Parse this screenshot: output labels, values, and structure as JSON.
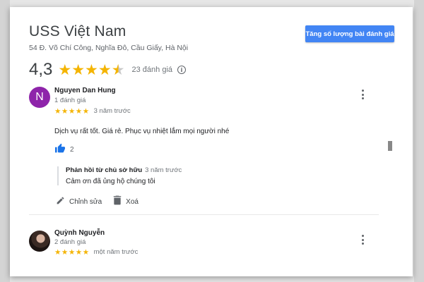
{
  "place": {
    "name": "USS Việt Nam",
    "address": "54 Đ. Võ Chí Công, Nghĩa Đô, Cầu Giấy, Hà Nội"
  },
  "cta_label": "Tăng số lượng bài đánh giá",
  "rating": {
    "value": "4,3",
    "stars": 4.3,
    "count_label": "23 đánh giá",
    "star_color": "#f4b400"
  },
  "reviews": [
    {
      "name": "Nguyen Dan Hung",
      "avatar_letter": "N",
      "avatar_color": "#8e24aa",
      "meta": "1 đánh giá",
      "stars": 5,
      "time": "3 năm trước",
      "text": "Dịch vụ rất tốt. Giá rẻ. Phục vụ nhiệt lắm mọi người nhé",
      "likes": "2",
      "owner_reply": {
        "title": "Phản hồi từ chủ sở hữu",
        "time": "3 năm trước",
        "text": "Cảm ơn đã ủng hộ chúng tôi"
      },
      "actions": {
        "edit": "Chỉnh sửa",
        "delete": "Xoá"
      }
    },
    {
      "name": "Quỳnh Nguyễn",
      "meta": "2 đánh giá",
      "stars": 5,
      "time": "một năm trước"
    }
  ],
  "accent_color": "#4285f4",
  "icons": [
    "info-icon",
    "thumbs-up-icon",
    "pencil-icon",
    "trash-icon",
    "more-vert-icon"
  ]
}
